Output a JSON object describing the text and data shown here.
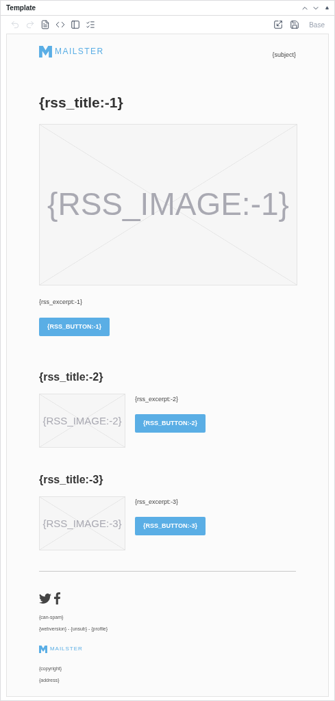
{
  "panel": {
    "title": "Template"
  },
  "toolbar": {
    "tools": [
      {
        "kind": "undo",
        "disabled": true
      },
      {
        "kind": "redo",
        "disabled": true
      },
      {
        "kind": "file",
        "disabled": false
      },
      {
        "kind": "code",
        "disabled": false
      },
      {
        "kind": "layout",
        "disabled": false
      },
      {
        "kind": "list",
        "disabled": false
      }
    ],
    "right_tools": [
      {
        "kind": "expand",
        "disabled": false
      },
      {
        "kind": "save",
        "disabled": false
      }
    ],
    "base_label": "Base"
  },
  "header": {
    "logo_text": "MAILSTER",
    "subject": "{subject}"
  },
  "feature": {
    "title": "{rss_title:-1}",
    "image_text": "{RSS_IMAGE:-1}",
    "excerpt": "{rss_excerpt:-1}",
    "button": "{RSS_BUTTON:-1}"
  },
  "posts": [
    {
      "title": "{rss_title:-2}",
      "image_text": "{RSS_IMAGE:-2}",
      "excerpt": "{rss_excerpt:-2}",
      "button": "{RSS_BUTTON:-2}"
    },
    {
      "title": "{rss_title:-3}",
      "image_text": "{RSS_IMAGE:-3}",
      "excerpt": "{rss_excerpt:-3}",
      "button": "{RSS_BUTTON:-3}"
    }
  ],
  "footer": {
    "social": [
      {
        "kind": "twitter"
      },
      {
        "kind": "facebook"
      }
    ],
    "can_spam": "{can-spam}",
    "links": "{webversion} - {unsub} - {profile}",
    "logo_text": "MAILSTER",
    "copyright": "{copyright}",
    "address": "{address}"
  }
}
